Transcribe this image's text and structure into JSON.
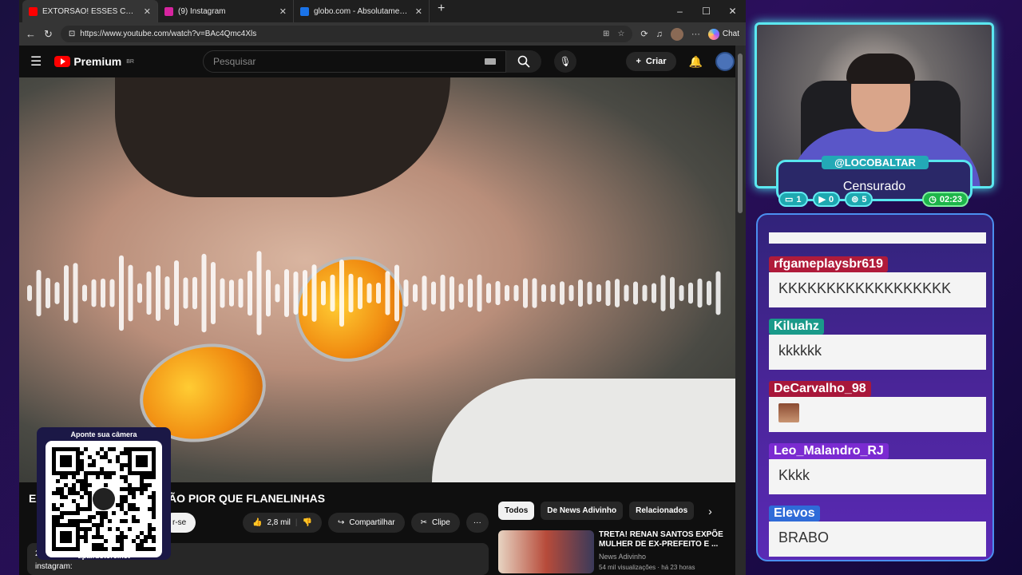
{
  "browser": {
    "tabs": [
      {
        "label": "EXTORSÃO! ESSES CARAS TÃO PIOR",
        "color": "#ff0000",
        "active": true
      },
      {
        "label": "(9) Instagram",
        "color": "#d6249f",
        "active": false
      },
      {
        "label": "globo.com - Absolutamente tudo",
        "color": "#1a73e8",
        "active": false
      }
    ],
    "url": "https://www.youtube.com/watch?v=BAc4Qmc4Xls",
    "chat_button": "Chat"
  },
  "youtube": {
    "logo": "Premium",
    "region": "BR",
    "search_placeholder": "Pesquisar",
    "create_label": "Criar",
    "video_title_start": "EX",
    "video_title_end": "TÃO PIOR QUE FLANELINHAS",
    "subscribe_label": "r-se",
    "likes": "2,8 mil",
    "share_label": "Compartilhar",
    "clip_label": "Clipe",
    "description_line": "instagram:",
    "description_mark": "2",
    "chips": [
      "Todos",
      "De News Adivinho",
      "Relacionados"
    ],
    "recommendation": {
      "title": "TRETA! RENAN SANTOS EXPÕE MULHER DE EX-PREFEITO E ...",
      "channel": "News Adivinho",
      "meta": "54 mil visualizações · há 23 horas"
    }
  },
  "overlay": {
    "qr_top": "Aponte sua câmera",
    "qr_bottom": "tipa.rbstore.net"
  },
  "streamer": {
    "handle": "@LOCOBALTAR",
    "status": "Censurado",
    "counters": {
      "chat": "1",
      "youtube": "0",
      "other": "5",
      "time": "02:23"
    }
  },
  "chat": {
    "messages": [
      {
        "user": "rfgameplaysbr619",
        "text": "KKKKKKKKKKKKKKKKKK",
        "color": "#b01b3a"
      },
      {
        "user": "Kiluahz",
        "text": "kkkkkk",
        "color": "#1a9a8a"
      },
      {
        "user": "DeCarvalho_98",
        "text": "",
        "color": "#a8173a",
        "emote": true
      },
      {
        "user": "Leo_Malandro_RJ",
        "text": "Kkkk",
        "color": "#7b2bd1"
      },
      {
        "user": "Elevos",
        "text": "BRABO",
        "color": "#2f6bd8"
      }
    ]
  }
}
